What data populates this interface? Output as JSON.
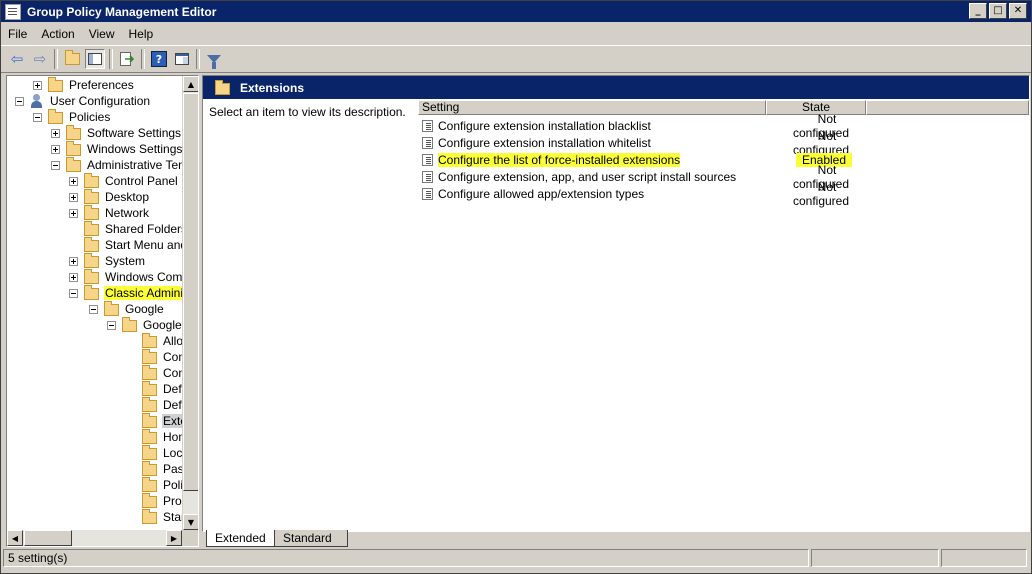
{
  "window": {
    "title": "Group Policy Management Editor"
  },
  "menu": [
    "File",
    "Action",
    "View",
    "Help"
  ],
  "toolbar": {
    "buttons": [
      {
        "icon": "back-arrow-icon"
      },
      {
        "icon": "forward-arrow-icon"
      },
      {
        "icon": "up-folder-icon"
      },
      {
        "icon": "show-hide-console-tree-icon"
      },
      {
        "icon": "export-list-icon"
      },
      {
        "icon": "help-icon"
      },
      {
        "icon": "properties-icon"
      },
      {
        "icon": "filter-icon"
      }
    ]
  },
  "tree": {
    "items": [
      {
        "label": "Preferences",
        "expander": "plus",
        "icon": "folder"
      },
      {
        "label": "User Configuration",
        "expander": "minus",
        "icon": "user"
      },
      {
        "label": "Policies",
        "expander": "minus",
        "icon": "folder"
      },
      {
        "label": "Software Settings",
        "expander": "plus",
        "icon": "folder"
      },
      {
        "label": "Windows Settings",
        "expander": "plus",
        "icon": "folder"
      },
      {
        "label": "Administrative Temp",
        "expander": "minus",
        "icon": "folder"
      },
      {
        "label": "Control Panel",
        "expander": "plus",
        "icon": "folder"
      },
      {
        "label": "Desktop",
        "expander": "plus",
        "icon": "folder"
      },
      {
        "label": "Network",
        "expander": "plus",
        "icon": "folder"
      },
      {
        "label": "Shared Folders",
        "expander": "none",
        "icon": "folder"
      },
      {
        "label": "Start Menu and",
        "expander": "none",
        "icon": "folder"
      },
      {
        "label": "System",
        "expander": "plus",
        "icon": "folder"
      },
      {
        "label": "Windows Compo",
        "expander": "plus",
        "icon": "folder"
      },
      {
        "label": "Classic Administ",
        "expander": "minus",
        "icon": "folder",
        "highlight": "yellow"
      },
      {
        "label": "Google",
        "expander": "minus",
        "icon": "folder"
      },
      {
        "label": "Google",
        "expander": "minus",
        "icon": "folder"
      },
      {
        "label": "Allo",
        "expander": "none",
        "icon": "folder"
      },
      {
        "label": "Con",
        "expander": "none",
        "icon": "folder"
      },
      {
        "label": "Con",
        "expander": "none",
        "icon": "folder"
      },
      {
        "label": "Def",
        "expander": "none",
        "icon": "folder"
      },
      {
        "label": "Def",
        "expander": "none",
        "icon": "folder"
      },
      {
        "label": "Exte",
        "expander": "none",
        "icon": "folder",
        "highlight": "selected"
      },
      {
        "label": "Hom",
        "expander": "none",
        "icon": "folder"
      },
      {
        "label": "Loca",
        "expander": "none",
        "icon": "folder"
      },
      {
        "label": "Pas",
        "expander": "none",
        "icon": "folder"
      },
      {
        "label": "Poli",
        "expander": "none",
        "icon": "folder"
      },
      {
        "label": "Prox",
        "expander": "none",
        "icon": "folder"
      },
      {
        "label": "Star",
        "expander": "none",
        "icon": "folder"
      }
    ]
  },
  "details": {
    "title": "Extensions",
    "description": "Select an item to view its description.",
    "columns": {
      "setting": "Setting",
      "state": "State"
    },
    "rows": [
      {
        "setting": "Configure extension installation blacklist",
        "state": "Not configured"
      },
      {
        "setting": "Configure extension installation whitelist",
        "state": "Not configured"
      },
      {
        "setting": "Configure the list of force-installed extensions",
        "state": "Enabled",
        "highlight": true
      },
      {
        "setting": "Configure extension, app, and user script install sources",
        "state": "Not configured"
      },
      {
        "setting": "Configure allowed app/extension types",
        "state": "Not configured"
      }
    ]
  },
  "tabs": [
    "Extended",
    "Standard"
  ],
  "status": {
    "text": "5 setting(s)"
  },
  "colors": {
    "titlebar": "#0a246a",
    "highlight": "#fbff37",
    "face": "#d4d0c8"
  }
}
